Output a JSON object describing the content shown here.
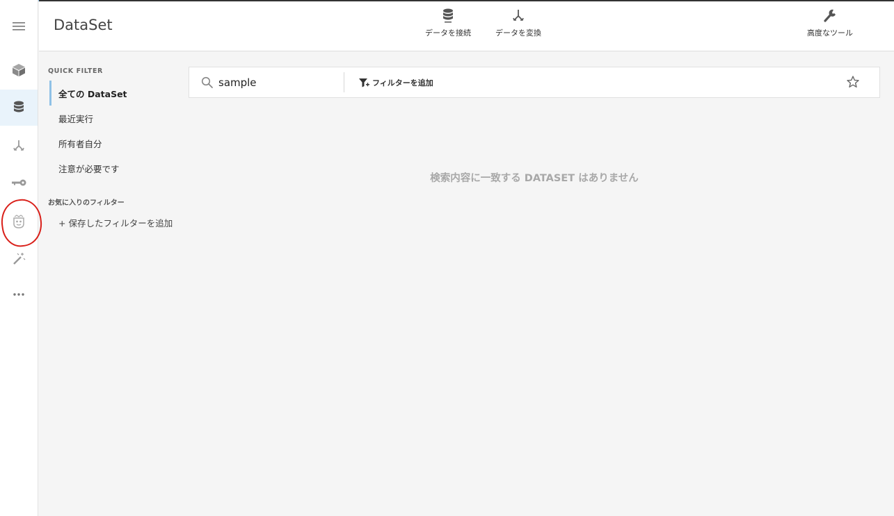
{
  "app": {
    "title": "DataSet"
  },
  "rail": {
    "items": [
      {
        "icon": "menu-icon"
      },
      {
        "icon": "cube-icon"
      },
      {
        "icon": "database-icon",
        "active": true
      },
      {
        "icon": "transform-icon"
      },
      {
        "icon": "key-icon"
      },
      {
        "icon": "robot-icon",
        "annotated": true
      },
      {
        "icon": "magic-wand-icon"
      },
      {
        "icon": "more-icon"
      }
    ],
    "annotation_color": "#d9201a"
  },
  "header": {
    "connect_label": "データを接続",
    "transform_label": "データを変換",
    "advanced_tools_label": "高度なツール"
  },
  "quick_filter": {
    "heading": "QUICK FILTER",
    "items": [
      {
        "label": "全ての DataSet",
        "active": true
      },
      {
        "label": "最近実行"
      },
      {
        "label": "所有者自分"
      },
      {
        "label": "注意が必要です"
      }
    ]
  },
  "favorites": {
    "heading": "お気に入りのフィルター",
    "add_label": "+ 保存したフィルターを追加"
  },
  "search": {
    "value": "sample",
    "add_filter_label": "フィルターを追加"
  },
  "results": {
    "empty_message": "検索内容に一致する DATASET はありません"
  },
  "colors": {
    "accent": "#8fc1e6",
    "active_rail_bg": "#e9f3fb",
    "empty_text": "#a8a8a8"
  }
}
